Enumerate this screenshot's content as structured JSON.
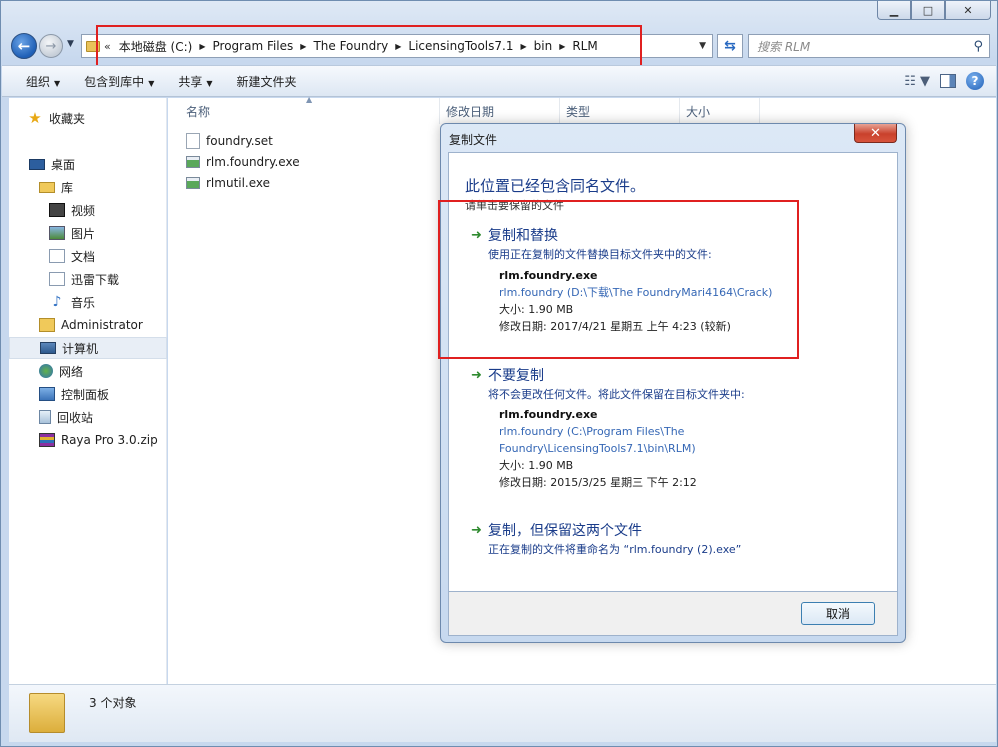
{
  "window": {
    "controls": [
      "minimize",
      "maximize",
      "close"
    ]
  },
  "nav": {
    "overflow": "«",
    "breadcrumbs": [
      "本地磁盘 (C:)",
      "Program Files",
      "The Foundry",
      "LicensingTools7.1",
      "bin",
      "RLM"
    ],
    "search_placeholder": "搜索 RLM"
  },
  "toolbar": {
    "organize": "组织",
    "include_library": "包含到库中",
    "share": "共享",
    "new_folder": "新建文件夹"
  },
  "sidebar": {
    "items": [
      {
        "label": "收藏夹",
        "icon": "star-icon"
      },
      {
        "label": "桌面",
        "icon": "desktop-icon"
      },
      {
        "label": "库",
        "icon": "library-icon"
      },
      {
        "label": "视频",
        "icon": "video-icon"
      },
      {
        "label": "图片",
        "icon": "picture-icon"
      },
      {
        "label": "文档",
        "icon": "document-icon"
      },
      {
        "label": "迅雷下载",
        "icon": "download-icon"
      },
      {
        "label": "音乐",
        "icon": "music-icon"
      },
      {
        "label": "Administrator",
        "icon": "user-folder-icon"
      },
      {
        "label": "计算机",
        "icon": "computer-icon"
      },
      {
        "label": "网络",
        "icon": "network-icon"
      },
      {
        "label": "控制面板",
        "icon": "control-panel-icon"
      },
      {
        "label": "回收站",
        "icon": "recycle-bin-icon"
      },
      {
        "label": "Raya Pro 3.0.zip",
        "icon": "zip-icon"
      }
    ]
  },
  "filelist": {
    "columns": [
      "名称",
      "修改日期",
      "类型",
      "大小"
    ],
    "files": [
      {
        "name": "foundry.set",
        "icon": "file-icon"
      },
      {
        "name": "rlm.foundry.exe",
        "icon": "exe-icon"
      },
      {
        "name": "rlmutil.exe",
        "icon": "exe-icon"
      }
    ]
  },
  "statusbar": {
    "count_text": "3 个对象"
  },
  "dialog": {
    "title": "复制文件",
    "heading": "此位置已经包含同名文件。",
    "subheading": "请单击要保留的文件",
    "options": [
      {
        "title": "复制和替换",
        "desc": "使用正在复制的文件替换目标文件夹中的文件:",
        "filename": "rlm.foundry.exe",
        "path_line1": "rlm.foundry (D:\\下载\\The FoundryMari4164\\Crack)",
        "path_line2": "",
        "size": "大小: 1.90 MB",
        "modified": "修改日期: 2017/4/21 星期五 上午 4:23 (较新)"
      },
      {
        "title": "不要复制",
        "desc": "将不会更改任何文件。将此文件保留在目标文件夹中:",
        "filename": "rlm.foundry.exe",
        "path_line1": "rlm.foundry (C:\\Program Files\\The",
        "path_line2": "Foundry\\LicensingTools7.1\\bin\\RLM)",
        "size": "大小: 1.90 MB",
        "modified": "修改日期: 2015/3/25 星期三 下午 2:12"
      },
      {
        "title": "复制，但保留这两个文件",
        "desc": "正在复制的文件将重命名为 “rlm.foundry (2).exe”"
      }
    ],
    "cancel_label": "取消"
  },
  "colors": {
    "annotation_red": "#e02020",
    "dialog_link_blue": "#1a3c8a",
    "path_blue": "#3567b5"
  }
}
